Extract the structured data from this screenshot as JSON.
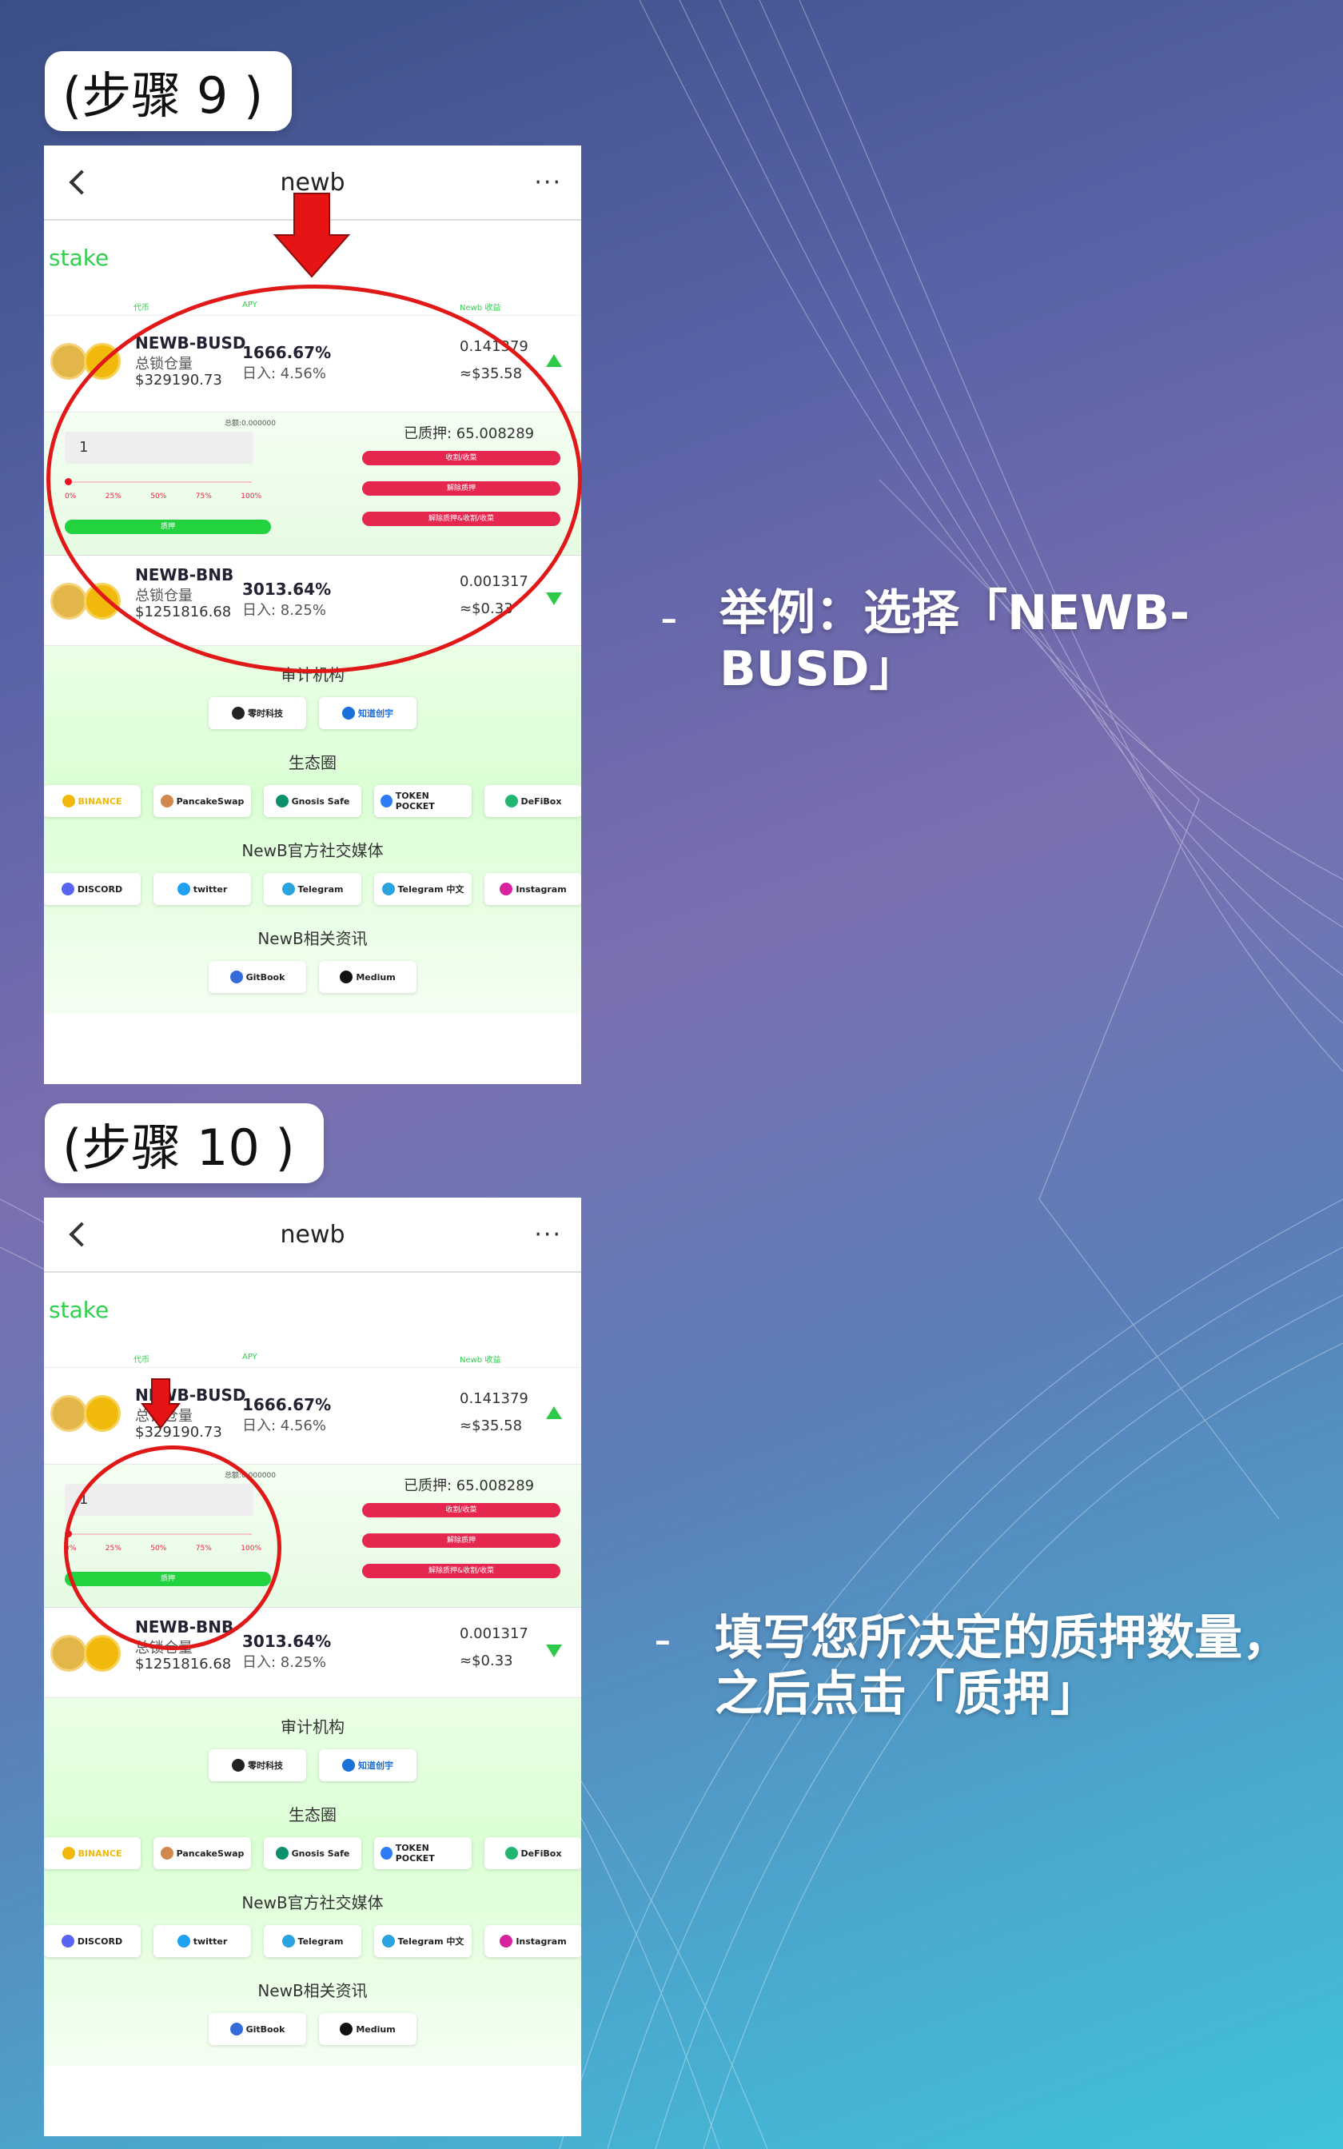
{
  "steps": {
    "step9_label": "(步骤 9 )",
    "step10_label": "(步骤 10 )"
  },
  "phone": {
    "title": "newb",
    "more": "···",
    "stake_label": "stake",
    "col_headers": {
      "coin": "代币",
      "apy": "APY",
      "earn": "Newb 收益"
    },
    "pools": [
      {
        "pair": "NEWB-BUSD",
        "tvl_label": "总锁仓量",
        "tvl": "$329190.73",
        "apy": "1666.67%",
        "daily": "日入: 4.56%",
        "earn": "0.141379",
        "earn_usd": "≈$35.58",
        "trend": "up"
      },
      {
        "pair": "NEWB-BNB",
        "tvl_label": "总锁仓量",
        "tvl": "$1251816.68",
        "apy": "3013.64%",
        "daily": "日入: 8.25%",
        "earn": "0.001317",
        "earn_usd": "≈$0.33",
        "trend": "down"
      }
    ],
    "panel": {
      "balance": "总额:0.000000",
      "input_value": "1",
      "ticks": [
        "0%",
        "25%",
        "50%",
        "75%",
        "100%"
      ],
      "stake_button": "质押",
      "staked": "已质押: 65.008289",
      "btn_harvest": "收割/收菜",
      "btn_unstake": "解除质押",
      "btn_unstake_harvest": "解除质押&收割/收菜"
    },
    "sections": {
      "audit": "审计机构",
      "ecosystem": "生态圈",
      "social": "NewB官方社交媒体",
      "news": "NewB相关资讯"
    },
    "audit_logos": [
      "零时科技",
      "知道创宇"
    ],
    "eco_logos": [
      "BINANCE",
      "PancakeSwap",
      "Gnosis Safe",
      "TOKEN POCKET",
      "DeFiBox"
    ],
    "social_logos": [
      "DISCORD",
      "twitter",
      "Telegram",
      "Telegram 中文",
      "Instagram"
    ],
    "news_logos": [
      "GitBook",
      "Medium"
    ]
  },
  "bullets": {
    "b1_dash": "-",
    "b1_text": "举例：选择「NEWB-BUSD」",
    "b2_dash": "-",
    "b2_text": "填写您所决定的质押数量，之后点击「质押」"
  }
}
